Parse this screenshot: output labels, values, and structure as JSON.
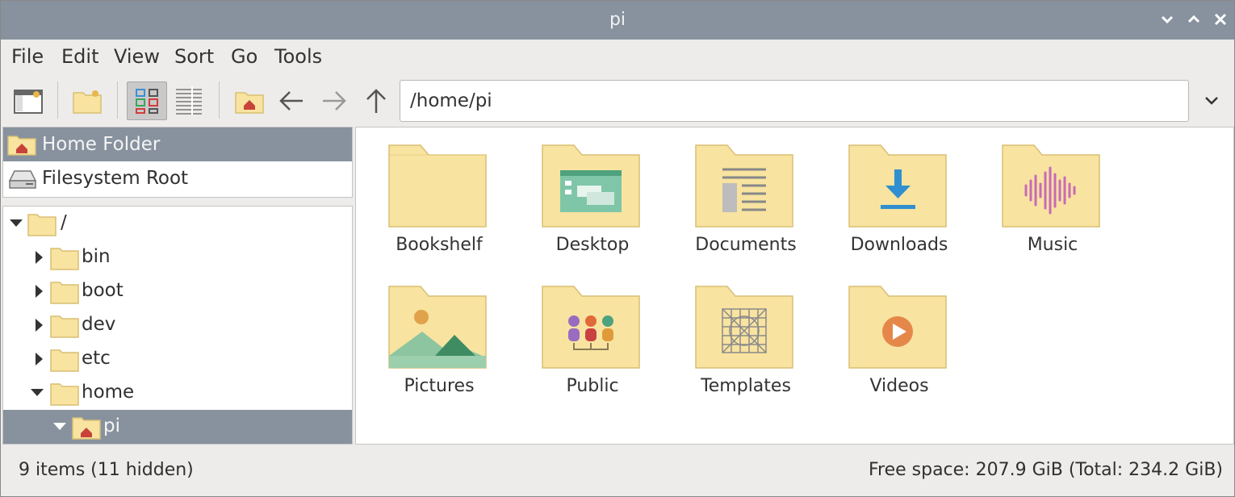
{
  "window": {
    "title": "pi"
  },
  "menu": [
    "File",
    "Edit",
    "View",
    "Sort",
    "Go",
    "Tools"
  ],
  "toolbar": {
    "path_value": "/home/pi",
    "icons": [
      "sidepane-icon",
      "new-folder-icon",
      "icon-view-icon",
      "list-view-icon",
      "home-icon",
      "back-arrow-icon",
      "forward-arrow-icon",
      "up-arrow-icon"
    ]
  },
  "places": [
    {
      "label": "Home Folder",
      "icon": "home-folder-icon",
      "selected": true
    },
    {
      "label": "Filesystem Root",
      "icon": "drive-icon",
      "selected": false
    }
  ],
  "tree": [
    {
      "label": "/",
      "expanded": true,
      "depth": 0
    },
    {
      "label": "bin",
      "expanded": false,
      "depth": 1
    },
    {
      "label": "boot",
      "expanded": false,
      "depth": 1
    },
    {
      "label": "dev",
      "expanded": false,
      "depth": 1
    },
    {
      "label": "etc",
      "expanded": false,
      "depth": 1
    },
    {
      "label": "home",
      "expanded": true,
      "depth": 1
    },
    {
      "label": "pi",
      "expanded": true,
      "depth": 2,
      "selected": true
    }
  ],
  "files": [
    {
      "name": "Bookshelf",
      "icon": "folder-icon"
    },
    {
      "name": "Desktop",
      "icon": "desktop-folder-icon"
    },
    {
      "name": "Documents",
      "icon": "documents-folder-icon"
    },
    {
      "name": "Downloads",
      "icon": "downloads-folder-icon"
    },
    {
      "name": "Music",
      "icon": "music-folder-icon"
    },
    {
      "name": "Pictures",
      "icon": "pictures-folder-icon"
    },
    {
      "name": "Public",
      "icon": "public-folder-icon"
    },
    {
      "name": "Templates",
      "icon": "templates-folder-icon"
    },
    {
      "name": "Videos",
      "icon": "videos-folder-icon"
    }
  ],
  "status": {
    "items": "9 items (11 hidden)",
    "free_space": "Free space: 207.9 GiB (Total: 234.2 GiB)"
  },
  "colors": {
    "titlebar": "#87929e",
    "selection": "#87929e",
    "folder_fill": "#f8e3a0",
    "folder_stroke": "#d8bf72"
  }
}
